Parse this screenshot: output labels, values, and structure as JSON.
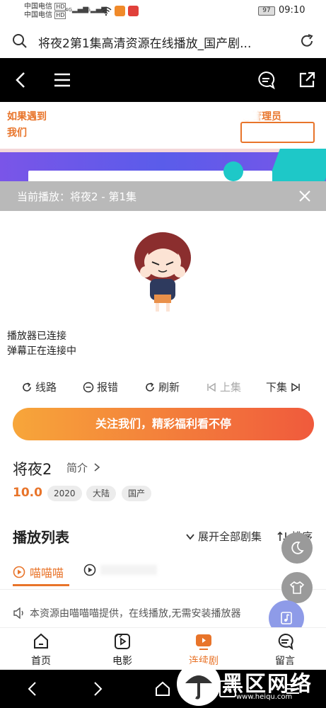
{
  "status_bar": {
    "carrier_1": "中国电信",
    "carrier_2": "中国电信",
    "hd_1": "HD",
    "hd_2": "HD",
    "net_1": "4G",
    "net_2": "4G",
    "battery": "97",
    "time": "09:10"
  },
  "browser": {
    "title": "将夜2第1集高清资源在线播放_国产剧..."
  },
  "banner": {
    "line1": "如果遇到",
    "line1_tail": "@管理员",
    "line2": "我们"
  },
  "now_playing": {
    "label": "当前播放：将夜2 - 第1集"
  },
  "player": {
    "status_1": "播放器已连接",
    "status_2": "弹幕正在连接中"
  },
  "controls": {
    "route": "线路",
    "report": "报错",
    "refresh": "刷新",
    "prev": "上集",
    "next": "下集"
  },
  "follow_button": "关注我们，精彩福利看不停",
  "show": {
    "title": "将夜2",
    "intro": "简介",
    "rating": "10.0",
    "tags": [
      "2020",
      "大陆",
      "国产"
    ]
  },
  "playlist": {
    "title": "播放列表",
    "expand": "展开全部剧集",
    "sort": "排序",
    "sources": [
      "喵喵喵"
    ],
    "notice": "本资源由喵喵喵提供，在线播放,无需安装播放器"
  },
  "tabbar": {
    "items": [
      {
        "label": "首页",
        "icon": "home-icon"
      },
      {
        "label": "电影",
        "icon": "film-icon"
      },
      {
        "label": "连续剧",
        "icon": "tv-icon"
      },
      {
        "label": "留言",
        "icon": "message-icon"
      }
    ]
  },
  "system_nav": {
    "tabs_count": "4"
  },
  "watermark": {
    "main": "黑区网络",
    "sub": "www.heiqu.com"
  },
  "colors": {
    "accent": "#e8742a",
    "gradient_start": "#f7a63a",
    "gradient_end": "#f05a3c",
    "navbar": "#000000",
    "now_playing_bg": "#b9b9b9"
  }
}
